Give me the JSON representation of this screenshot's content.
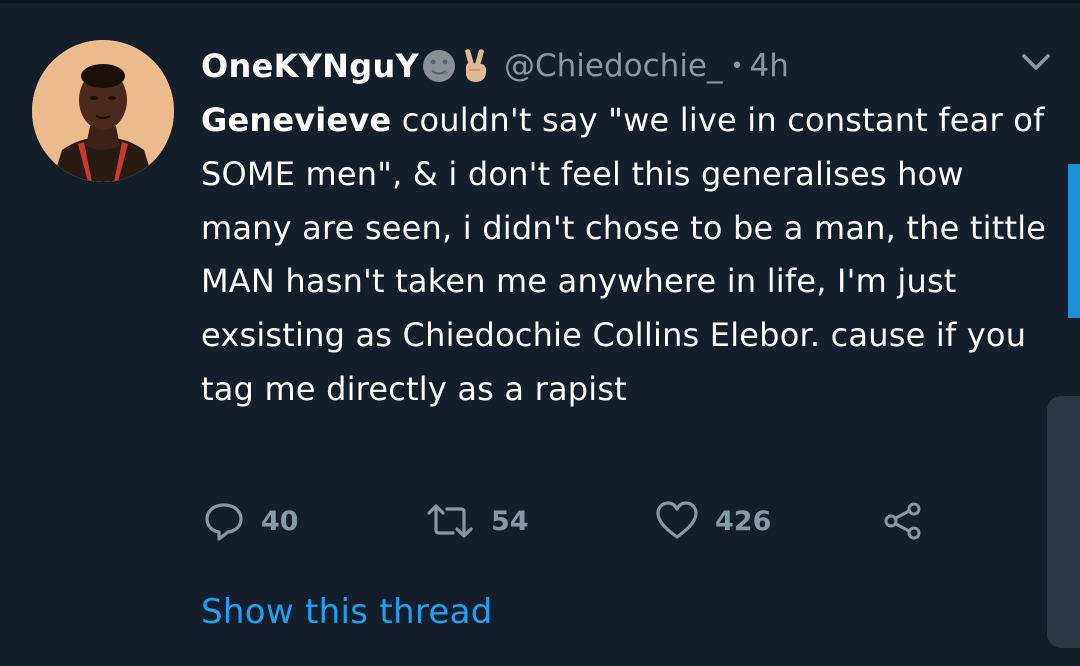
{
  "tweet": {
    "author": {
      "display_name": "OneKYNguY",
      "emojis": [
        "moon-face-emoji",
        "victory-hand-emoji"
      ],
      "handle": "@Chiedochie_",
      "separator": "•",
      "time": "4h"
    },
    "text_lead": "Genevieve",
    "text_body": " couldn't say \"we live in constant fear of SOME men\", & i don't feel this generalises how many are seen, i didn't chose to be a man, the tittle MAN hasn't taken me anywhere in life, I'm just exsisting as Chiedochie Collins Elebor. cause if you tag me directly as a rapist",
    "actions": {
      "reply": {
        "icon": "reply-icon",
        "count": "40"
      },
      "retweet": {
        "icon": "retweet-icon",
        "count": "54"
      },
      "like": {
        "icon": "heart-icon",
        "count": "426"
      },
      "share": {
        "icon": "share-icon"
      }
    },
    "show_thread": "Show this thread"
  },
  "colors": {
    "background": "#151f2b",
    "text": "#ffffff",
    "secondary": "#8899a6",
    "link": "#1da1f2"
  }
}
